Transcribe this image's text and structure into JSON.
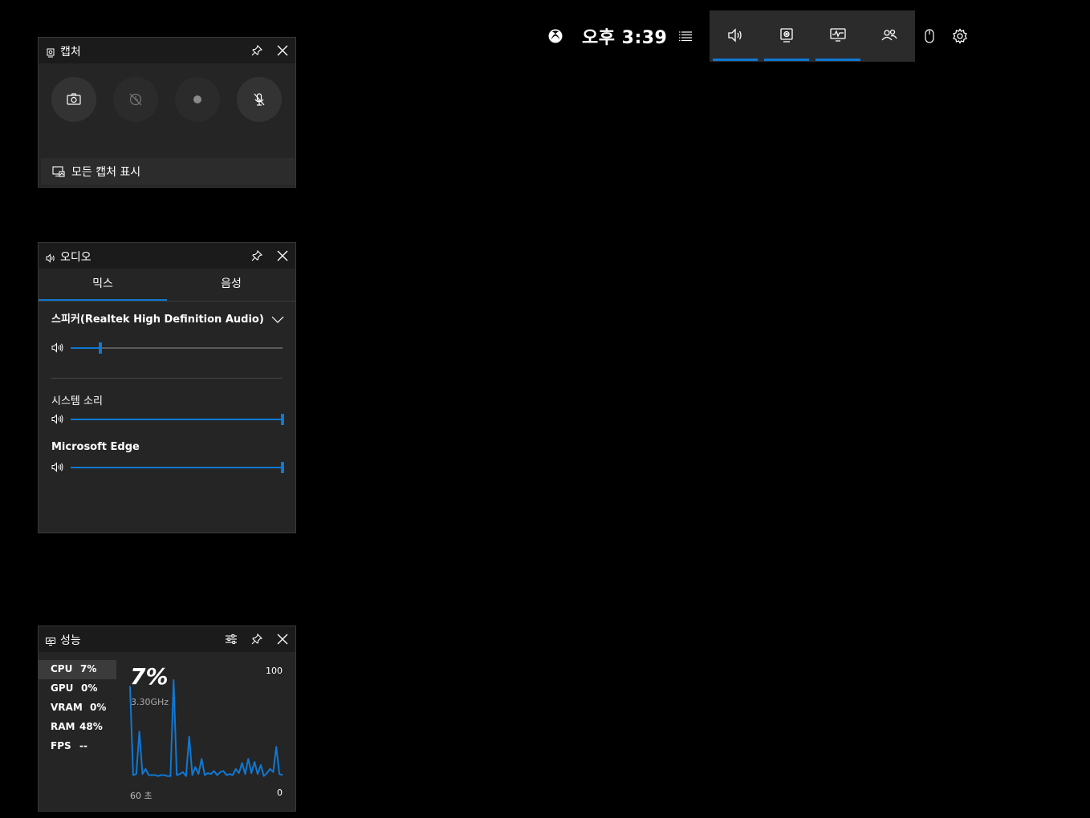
{
  "topbar": {
    "clock": "오후 3:39",
    "widgets": [
      {
        "name": "audio",
        "icon": "speaker-icon",
        "active": true
      },
      {
        "name": "capture",
        "icon": "capture-icon",
        "active": true
      },
      {
        "name": "performance",
        "icon": "performance-icon",
        "active": true
      },
      {
        "name": "social",
        "icon": "people-icon",
        "active": false
      }
    ],
    "accent": "#0f78d4"
  },
  "capture": {
    "title": "캡처",
    "buttons": [
      "screenshot",
      "record-last",
      "record",
      "mic-off"
    ],
    "show_all": "모든 캡처 표시"
  },
  "audio": {
    "title": "오디오",
    "tabs": [
      "믹스",
      "음성"
    ],
    "active_tab": "믹스",
    "device": "스피커(Realtek High Definition Audio)",
    "device_volume": 0.14,
    "apps": [
      {
        "name": "시스템 소리",
        "volume": 1.0
      },
      {
        "name": "Microsoft Edge",
        "volume": 1.0
      }
    ]
  },
  "performance": {
    "title": "성능",
    "metrics": [
      {
        "label": "CPU",
        "value": "7%"
      },
      {
        "label": "GPU",
        "value": "0%"
      },
      {
        "label": "VRAM",
        "value": "0%"
      },
      {
        "label": "RAM",
        "value": "48%"
      },
      {
        "label": "FPS",
        "value": "--"
      }
    ],
    "selected": "CPU",
    "big_value": "7%",
    "frequency": "3.30GHz",
    "max_label": "100",
    "min_label": "0",
    "time_label": "60 초",
    "cpu_history": [
      90,
      2,
      3,
      45,
      3,
      8,
      2,
      2,
      2,
      1,
      2,
      2,
      1,
      1,
      96,
      2,
      3,
      5,
      1,
      40,
      2,
      10,
      3,
      18,
      2,
      4,
      3,
      6,
      2,
      5,
      6,
      2,
      3,
      2,
      8,
      4,
      14,
      3,
      18,
      4,
      15,
      3,
      12,
      1,
      4,
      8,
      5,
      30,
      3,
      2
    ]
  }
}
